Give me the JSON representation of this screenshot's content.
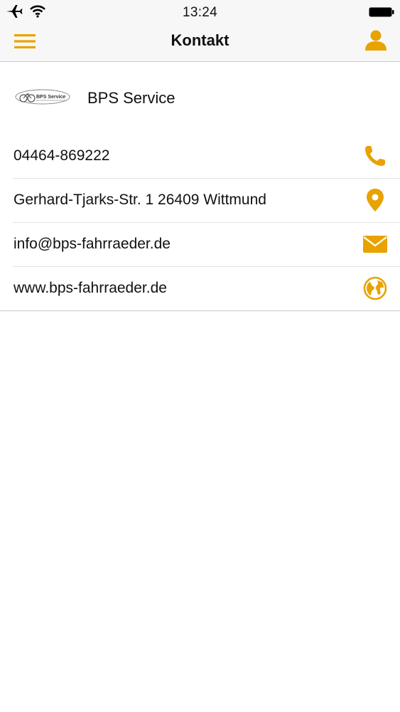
{
  "status_bar": {
    "time": "13:24",
    "icons": [
      "airplane-icon",
      "wifi-icon",
      "battery-icon"
    ]
  },
  "nav": {
    "title": "Kontakt",
    "left_icon": "hamburger-menu-icon",
    "right_icon": "user-profile-icon"
  },
  "company": {
    "logo_text": "BPS Service",
    "name": "BPS Service"
  },
  "contacts": [
    {
      "text": "04464-869222",
      "icon": "phone-icon"
    },
    {
      "text": "Gerhard-Tjarks-Str. 1 26409 Wittmund",
      "icon": "map-pin-icon"
    },
    {
      "text": "info@bps-fahrraeder.de",
      "icon": "mail-icon"
    },
    {
      "text": "www.bps-fahrraeder.de",
      "icon": "globe-icon"
    }
  ],
  "colors": {
    "accent": "#E8A300",
    "text": "#111111",
    "bar_background": "#F7F7F7",
    "divider": "#E3E3E3"
  }
}
